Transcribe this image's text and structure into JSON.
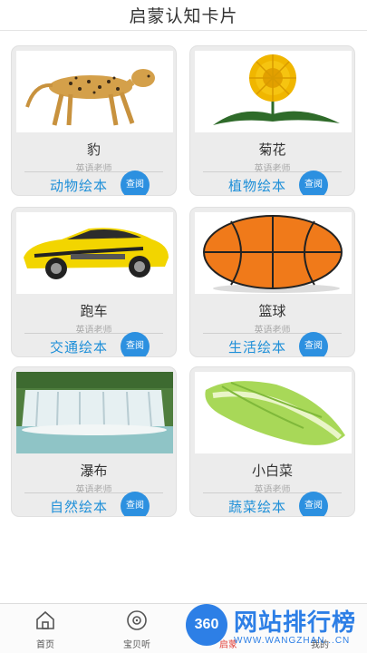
{
  "header": {
    "title": "启蒙认知卡片"
  },
  "cards": [
    {
      "name": "豹",
      "teacher": "英语老师",
      "book": "动物绘本",
      "action": "查阅",
      "picture": "cheetah"
    },
    {
      "name": "菊花",
      "teacher": "英语老师",
      "book": "植物绘本",
      "action": "查阅",
      "picture": "chrysanthemum"
    },
    {
      "name": "跑车",
      "teacher": "英语老师",
      "book": "交通绘本",
      "action": "查阅",
      "picture": "sports-car"
    },
    {
      "name": "篮球",
      "teacher": "英语老师",
      "book": "生活绘本",
      "action": "查阅",
      "picture": "basketball"
    },
    {
      "name": "瀑布",
      "teacher": "英语老师",
      "book": "自然绘本",
      "action": "查阅",
      "picture": "waterfall"
    },
    {
      "name": "小白菜",
      "teacher": "英语老师",
      "book": "蔬菜绘本",
      "action": "查阅",
      "picture": "bok-choy"
    }
  ],
  "tabbar": {
    "items": [
      {
        "label": "首页",
        "icon": "home-icon"
      },
      {
        "label": "宝贝听",
        "icon": "disc-icon"
      },
      {
        "label": "启蒙",
        "icon": "enlighten-icon"
      },
      {
        "label": "我的",
        "icon": "user-icon"
      }
    ]
  },
  "watermark": {
    "badge": "360",
    "text": "网站排行榜",
    "url": "WWW.WANGZHAN...CN"
  },
  "colors": {
    "accent": "#2c90e0",
    "active_tab": "#e2403a",
    "card_bg": "#ececec"
  }
}
